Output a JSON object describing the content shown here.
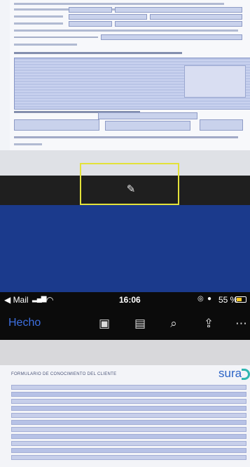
{
  "status_bar": {
    "back_app": "◀ Mail",
    "time": "16:06",
    "battery": "55 %"
  },
  "toolbar": {
    "done_label": "Hecho",
    "icons": [
      "camera-icon",
      "document-icon",
      "search-icon",
      "share-icon",
      "more-icon"
    ]
  },
  "document": {
    "form_title": "FORMULARIO DE CONOCIMIENTO DEL CLIENTE",
    "brand_logo": "sura"
  },
  "colors": {
    "background_blue": "#1b3a8c",
    "highlight": "#e3e23a",
    "done_blue": "#3d6fe0",
    "brand_blue": "#2b63c6",
    "brand_teal": "#2fb6b0"
  }
}
